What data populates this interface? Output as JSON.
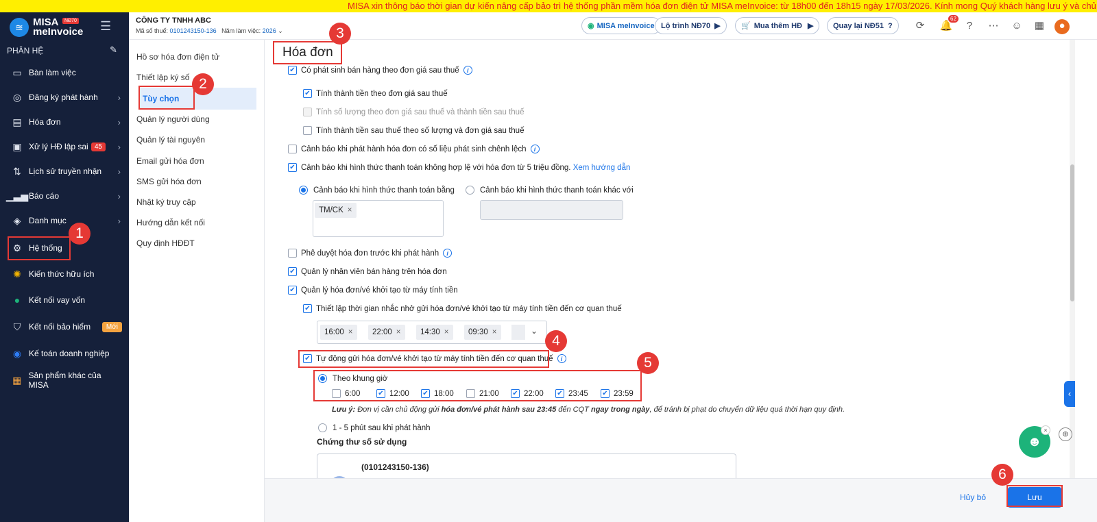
{
  "banner": "MISA xin thông báo thời gian dự kiến nâng cấp bảo trì hệ thống phần mềm hóa đơn điện tử MISA meInvoice: từ 18h00 đến 18h15 ngày 17/03/2026. Kính mong Quý khách hàng lưu ý và chủ động sắp",
  "logo": {
    "line1": "MISA",
    "line2": "meInvoice",
    "badge": "NĐ70"
  },
  "sidebar": {
    "section_title": "PHÂN HỆ",
    "items": [
      {
        "label": "Bàn làm việc",
        "icon": "monitor-icon"
      },
      {
        "label": "Đăng ký phát hành",
        "icon": "badge-icon"
      },
      {
        "label": "Hóa đơn",
        "icon": "document-icon"
      },
      {
        "label": "Xử lý HĐ lập sai",
        "icon": "edit-doc-icon",
        "count": "45"
      },
      {
        "label": "Lịch sử truyền nhận",
        "icon": "transfer-icon"
      },
      {
        "label": "Báo cáo",
        "icon": "chart-icon"
      },
      {
        "label": "Danh mục",
        "icon": "cube-icon"
      },
      {
        "label": "Hệ thống",
        "icon": "gear-icon"
      },
      {
        "label": "Kiến thức hữu ích",
        "icon": "bulb-icon"
      },
      {
        "label": "Kết nối vay vốn",
        "icon": "loan-icon"
      },
      {
        "label": "Kết nối bảo hiểm",
        "icon": "shield-icon",
        "new": "Mới"
      },
      {
        "label": "Kế toán doanh nghiệp",
        "icon": "accounting-icon"
      },
      {
        "label": "Sản phẩm khác của MISA",
        "icon": "apps-icon"
      }
    ]
  },
  "topbar": {
    "company": "CÔNG TY TNHH ABC",
    "tax_label": "Mã số thuế:",
    "tax_code": "0101243150-136",
    "year_label": "Năm làm việc:",
    "year": "2026",
    "pill_misa": "MISA meInvoice",
    "pill_roadmap": "Lộ trình NĐ70",
    "pill_buy": "Mua thêm HĐ",
    "pill_back": "Quay lại NĐ51",
    "notif_count": "62"
  },
  "submenu": {
    "items": [
      "Hồ sơ hóa đơn điện tử",
      "Thiết lập ký số",
      "Tùy chọn",
      "Quản lý người dùng",
      "Quản lý tài nguyên",
      "Email gửi hóa đơn",
      "SMS gửi hóa đơn",
      "Nhật ký truy cập",
      "Hướng dẫn kết nối",
      "Quy định HĐĐT"
    ]
  },
  "main": {
    "title": "Hóa đơn",
    "opt1": "Có phát sinh bán hàng theo đơn giá sau thuế",
    "opt1a": "Tính thành tiền theo đơn giá sau thuế",
    "opt1b": "Tính số lượng theo đơn giá sau thuế và thành tiền sau thuế",
    "opt1c": "Tính thành tiền sau thuế theo số lượng và đơn giá sau thuế",
    "opt2": "Cảnh báo khi phát hành hóa đơn có số liệu phát sinh chênh lệch",
    "opt3": "Cảnh báo khi hình thức thanh toán không hợp lệ với hóa đơn từ 5 triệu đồng.",
    "opt3_link": "Xem hướng dẫn",
    "radio_eq": "Cảnh báo khi hình thức thanh toán bằng",
    "radio_other": "Cảnh báo khi hình thức thanh toán khác với",
    "payment_tag": "TM/CK",
    "opt4": "Phê duyệt hóa đơn trước khi phát hành",
    "opt5": "Quản lý nhân viên bán hàng trên hóa đơn",
    "opt6": "Quản lý hóa đơn/vé khởi tạo từ máy tính tiền",
    "opt6a": "Thiết lập thời gian nhắc nhở gửi hóa đơn/vé khởi tạo từ máy tính tiền đến cơ quan thuế",
    "remind_times": [
      "16:00",
      "22:00",
      "14:30",
      "09:30"
    ],
    "opt7": "Tự động gửi hóa đơn/vé khởi tạo từ máy tính tiền đến cơ quan thuế",
    "radio_slot": "Theo khung giờ",
    "slots": [
      {
        "time": "6:00",
        "checked": false
      },
      {
        "time": "12:00",
        "checked": true
      },
      {
        "time": "18:00",
        "checked": true
      },
      {
        "time": "21:00",
        "checked": false
      },
      {
        "time": "22:00",
        "checked": true
      },
      {
        "time": "23:45",
        "checked": true
      },
      {
        "time": "23:59",
        "checked": true
      }
    ],
    "note_lead": "Lưu ý:",
    "note_a": " Đơn vị cần chủ động gửi ",
    "note_b": "hóa đơn/vé phát hành sau 23:45",
    "note_c": " đến CQT ",
    "note_d": "ngay trong ngày",
    "note_e": ", để tránh bị phạt do chuyển dữ liệu quá thời hạn quy định.",
    "radio_minutes": "1 - 5 phút sau khi phát hành",
    "cert_label": "Chứng thư số sử dụng",
    "cert_number": "(0101243150-136)"
  },
  "footer": {
    "cancel": "Hủy bỏ",
    "save": "Lưu"
  },
  "markers": [
    "1",
    "2",
    "3",
    "4",
    "5",
    "6"
  ]
}
